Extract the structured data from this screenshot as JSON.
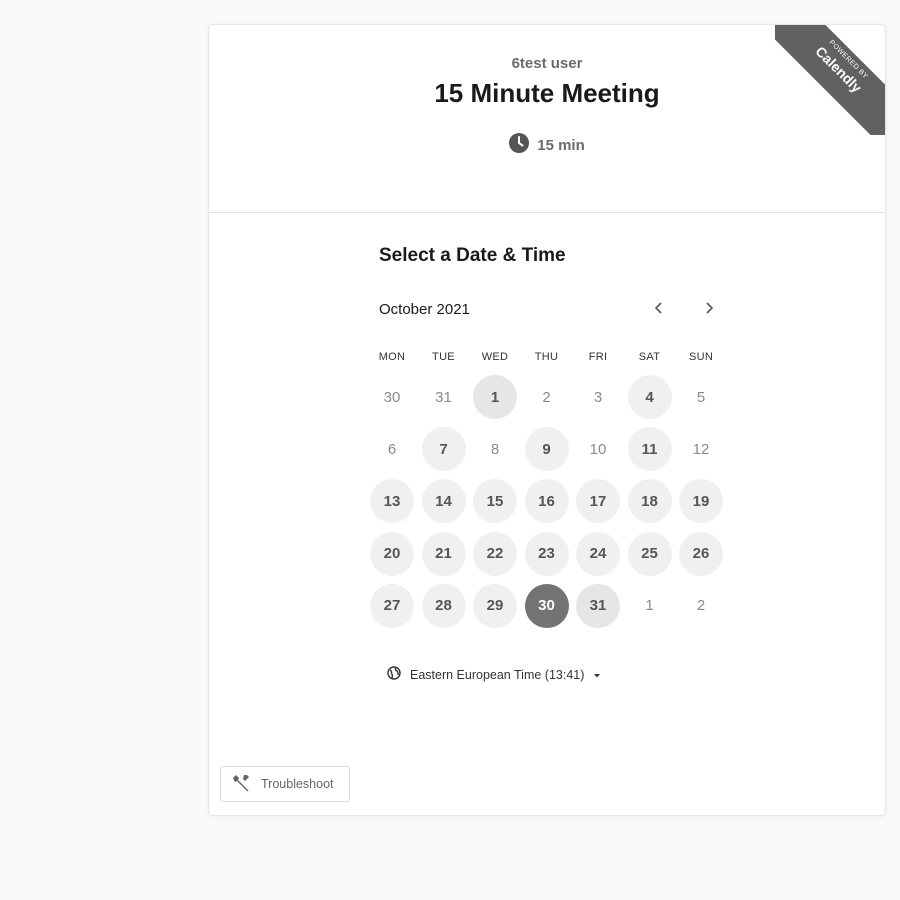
{
  "branding": {
    "powered_by": "POWERED BY",
    "brand": "Calendly"
  },
  "event": {
    "host": "6test user",
    "title": "15 Minute Meeting",
    "duration": "15 min",
    "duration_icon": "clock-icon"
  },
  "calendar": {
    "heading": "Select a Date & Time",
    "month_label": "October 2021",
    "prev_icon": "chevron-left-icon",
    "next_icon": "chevron-right-icon",
    "weekdays": [
      "MON",
      "TUE",
      "WED",
      "THU",
      "FRI",
      "SAT",
      "SUN"
    ],
    "days": [
      {
        "label": "30",
        "state": "off"
      },
      {
        "label": "31",
        "state": "off"
      },
      {
        "label": "1",
        "state": "avail-dark"
      },
      {
        "label": "2",
        "state": "off"
      },
      {
        "label": "3",
        "state": "off"
      },
      {
        "label": "4",
        "state": "avail"
      },
      {
        "label": "5",
        "state": "off"
      },
      {
        "label": "6",
        "state": "off"
      },
      {
        "label": "7",
        "state": "avail"
      },
      {
        "label": "8",
        "state": "off"
      },
      {
        "label": "9",
        "state": "avail"
      },
      {
        "label": "10",
        "state": "off"
      },
      {
        "label": "11",
        "state": "avail"
      },
      {
        "label": "12",
        "state": "off"
      },
      {
        "label": "13",
        "state": "avail"
      },
      {
        "label": "14",
        "state": "avail"
      },
      {
        "label": "15",
        "state": "avail"
      },
      {
        "label": "16",
        "state": "avail"
      },
      {
        "label": "17",
        "state": "avail"
      },
      {
        "label": "18",
        "state": "avail"
      },
      {
        "label": "19",
        "state": "avail"
      },
      {
        "label": "20",
        "state": "avail"
      },
      {
        "label": "21",
        "state": "avail"
      },
      {
        "label": "22",
        "state": "avail"
      },
      {
        "label": "23",
        "state": "avail"
      },
      {
        "label": "24",
        "state": "avail"
      },
      {
        "label": "25",
        "state": "avail"
      },
      {
        "label": "26",
        "state": "avail"
      },
      {
        "label": "27",
        "state": "avail"
      },
      {
        "label": "28",
        "state": "avail"
      },
      {
        "label": "29",
        "state": "avail"
      },
      {
        "label": "30",
        "state": "selected"
      },
      {
        "label": "31",
        "state": "avail-dark"
      },
      {
        "label": "1",
        "state": "off"
      },
      {
        "label": "2",
        "state": "off"
      }
    ]
  },
  "timezone": {
    "label": "Eastern European Time (13:41)",
    "icon": "globe-icon"
  },
  "troubleshoot": {
    "label": "Troubleshoot",
    "icon": "wrench-icon"
  },
  "colors": {
    "selected": "#737373",
    "available": "#f0f0f0",
    "ribbon": "#616161"
  }
}
